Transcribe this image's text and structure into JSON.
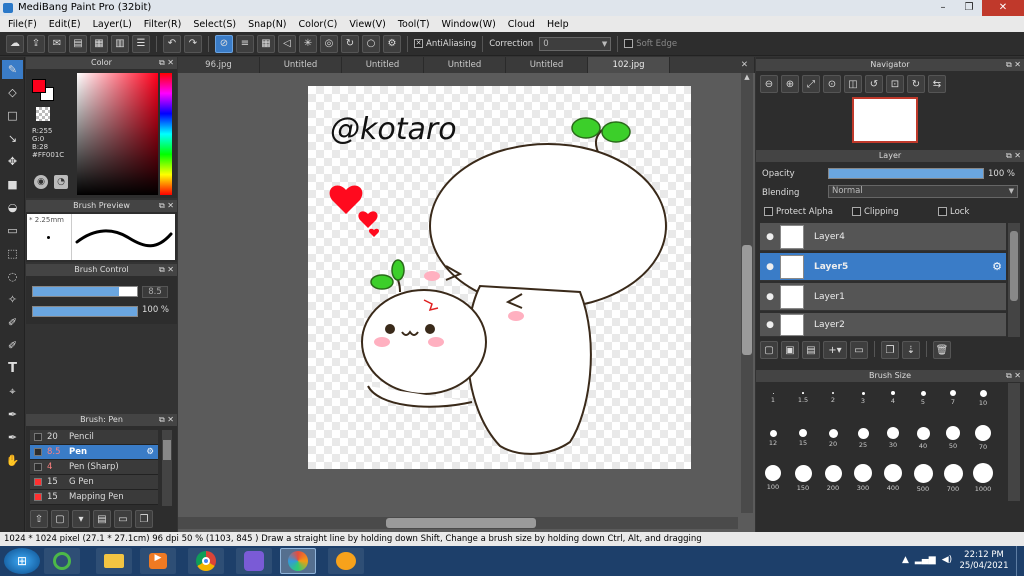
{
  "window": {
    "title": "MediBang Paint Pro (32bit)",
    "minimize": "–",
    "maximize": "❐",
    "close": "✕"
  },
  "menu": [
    "File(F)",
    "Edit(E)",
    "Layer(L)",
    "Filter(R)",
    "Select(S)",
    "Snap(N)",
    "Color(C)",
    "View(V)",
    "Tool(T)",
    "Window(W)",
    "Cloud",
    "Help"
  ],
  "toolbar": {
    "antialiasing": "AntiAliasing",
    "correction_label": "Correction",
    "correction_value": "0",
    "soft_edge": "Soft Edge"
  },
  "color_panel": {
    "title": "Color",
    "r": "R:255",
    "g": "G:0",
    "b": "B:28",
    "hex": "#FF001C",
    "primary": "#ff001c",
    "secondary": "#ffffff"
  },
  "brush_preview": {
    "title": "Brush Preview",
    "size": "2.25mm"
  },
  "brush_control": {
    "title": "Brush Control",
    "size_value": "8.5",
    "opacity_value": "100 %",
    "size_fraction": 0.83,
    "opacity_fraction": 1.0
  },
  "brush_list": {
    "title": "Brush: Pen",
    "items": [
      {
        "size": "20",
        "name": "Pencil",
        "color": "#2d2d2d"
      },
      {
        "size": "8.5",
        "name": "Pen",
        "color": "#2d2d2d"
      },
      {
        "size": "4",
        "name": "Pen (Sharp)",
        "color": "#2d2d2d"
      },
      {
        "size": "15",
        "name": "G Pen",
        "color": "#ff3030"
      },
      {
        "size": "15",
        "name": "Mapping Pen",
        "color": "#ff3030"
      }
    ]
  },
  "tabs": [
    "96.jpg",
    "Untitled",
    "Untitled",
    "Untitled",
    "Untitled",
    "102.jpg"
  ],
  "canvas": {
    "handwriting": "@kotaro"
  },
  "navigator": {
    "title": "Navigator"
  },
  "layer_panel": {
    "title": "Layer",
    "opacity_label": "Opacity",
    "opacity_value": "100 %",
    "opacity_fraction": 1.0,
    "blending_label": "Blending",
    "blending_value": "Normal",
    "protect_alpha": "Protect Alpha",
    "clipping": "Clipping",
    "lock": "Lock",
    "layers": [
      "Layer4",
      "Layer5",
      "Layer1",
      "Layer2"
    ]
  },
  "brush_size": {
    "title": "Brush Size",
    "sizes": [
      "1",
      "1.5",
      "2",
      "3",
      "4",
      "5",
      "7",
      "10",
      "12",
      "15",
      "20",
      "25",
      "30",
      "40",
      "50",
      "70",
      "100",
      "150",
      "200",
      "300",
      "400",
      "500",
      "700",
      "1000"
    ]
  },
  "status": {
    "text": "1024 * 1024 pixel   (27.1 * 27.1cm)   96 dpi   50 %   (1103, 845 )   Draw a straight line by holding down Shift, Change a brush size by holding down Ctrl, Alt, and dragging"
  },
  "taskbar": {
    "time": "22:12 PM",
    "date": "25/04/2021"
  }
}
